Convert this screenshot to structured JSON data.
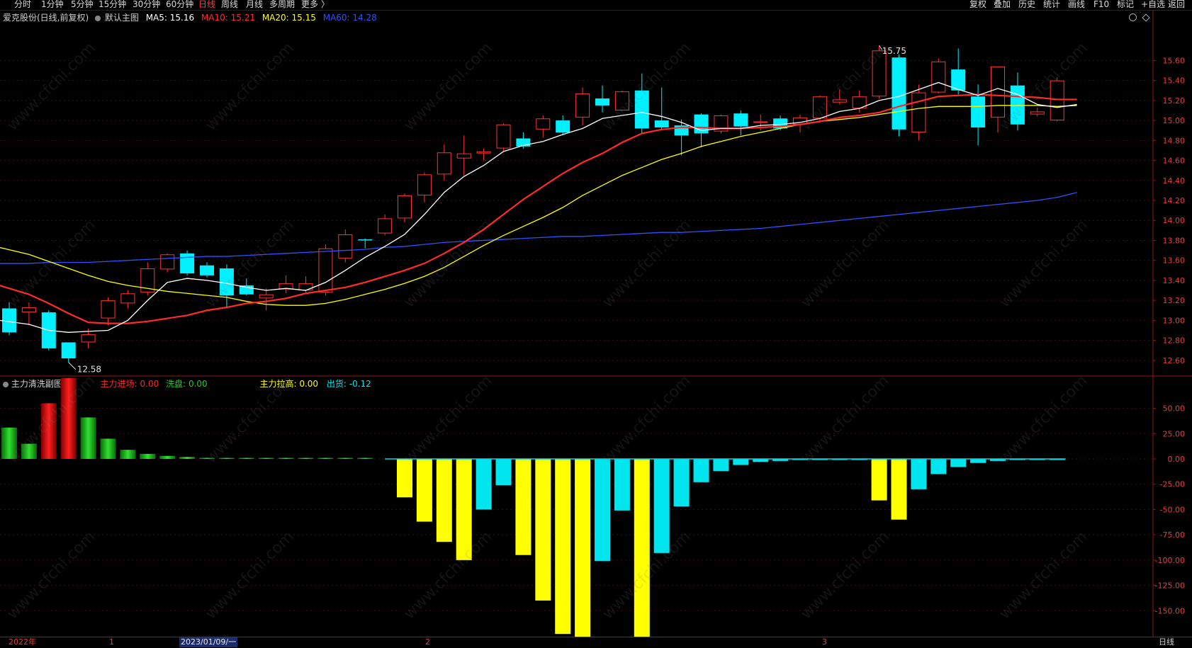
{
  "toolbar": {
    "tabs": [
      "分时",
      "1分钟",
      "5分钟",
      "15分钟",
      "30分钟",
      "60分钟",
      "日线",
      "周线",
      "月线",
      "多周期",
      "更多 〉"
    ],
    "active_tab": "日线",
    "right_buttons": [
      "复权",
      "叠加",
      "历史",
      "统计",
      "画线",
      "F10",
      "标记",
      "+自选",
      "返回"
    ]
  },
  "main_chart": {
    "title": "爱克股份(日线,前复权)",
    "template": "默认主图",
    "ma": [
      {
        "label": "MA5: ",
        "value": "15.16",
        "color": "#ffffff"
      },
      {
        "label": "MA10: ",
        "value": "15.21",
        "color": "#ff2a2a"
      },
      {
        "label": "MA20: ",
        "value": "15.15",
        "color": "#ffff00"
      },
      {
        "label": "MA60: ",
        "value": "14.28",
        "color": "#3050ff"
      }
    ],
    "high_label": "15.75",
    "low_label": "12.58",
    "y_ticks": [
      "15.60",
      "15.40",
      "15.20",
      "15.00",
      "14.80",
      "14.60",
      "14.40",
      "14.20",
      "14.00",
      "13.80",
      "13.60",
      "13.40",
      "13.20",
      "13.00",
      "12.80",
      "12.60"
    ]
  },
  "sub_chart": {
    "title": "主力清洗副图",
    "indicators": [
      {
        "label": "主力进场: ",
        "value": "0.00",
        "color": "#ff2a2a"
      },
      {
        "label": "洗盘: ",
        "value": "0.00",
        "color": "#20d020"
      },
      {
        "label": "主力拉高: ",
        "value": "0.00",
        "color": "#ffff00"
      },
      {
        "label": "出货: ",
        "value": "-0.12",
        "color": "#00e5ee"
      }
    ],
    "y_ticks": [
      "50.00",
      "25.00",
      "0.00",
      "-25.00",
      "-50.00",
      "-75.00",
      "-100.00",
      "-125.00",
      "-150.00"
    ]
  },
  "bottom_bar": {
    "labels": [
      "2022年",
      "1",
      "2023/01/09/一",
      "2",
      "3"
    ],
    "period": "日线"
  },
  "watermark": "www.cfchi.com",
  "chart_data": [
    {
      "type": "candlestick",
      "ylim": [
        12.45,
        15.95
      ],
      "candles": [
        [
          13.12,
          12.88,
          13.18,
          12.85
        ],
        [
          13.08,
          13.13,
          13.18,
          12.95
        ],
        [
          13.08,
          12.72,
          13.1,
          12.7
        ],
        [
          12.78,
          12.62,
          12.78,
          12.58
        ],
        [
          12.78,
          12.86,
          12.92,
          12.72
        ],
        [
          13.02,
          13.2,
          13.23,
          12.95
        ],
        [
          13.17,
          13.27,
          13.3,
          13.12
        ],
        [
          13.28,
          13.52,
          13.58,
          13.25
        ],
        [
          13.51,
          13.66,
          13.67,
          13.48
        ],
        [
          13.67,
          13.47,
          13.7,
          13.45
        ],
        [
          13.55,
          13.45,
          13.58,
          13.43
        ],
        [
          13.52,
          13.25,
          13.56,
          13.12
        ],
        [
          13.35,
          13.26,
          13.42,
          13.25
        ],
        [
          13.22,
          13.26,
          13.32,
          13.1
        ],
        [
          13.31,
          13.37,
          13.45,
          13.27
        ],
        [
          13.3,
          13.37,
          13.44,
          13.28
        ],
        [
          13.28,
          13.72,
          13.76,
          13.25
        ],
        [
          13.62,
          13.86,
          13.91,
          13.58
        ],
        [
          13.81,
          13.8,
          13.82,
          13.72
        ],
        [
          13.87,
          14.02,
          14.06,
          13.85
        ],
        [
          14.02,
          14.25,
          14.27,
          13.98
        ],
        [
          14.25,
          14.46,
          14.48,
          14.18
        ],
        [
          14.46,
          14.68,
          14.76,
          14.4
        ],
        [
          14.62,
          14.67,
          14.85,
          14.45
        ],
        [
          14.67,
          14.69,
          14.72,
          14.6
        ],
        [
          14.72,
          14.96,
          14.97,
          14.68
        ],
        [
          14.82,
          14.74,
          14.88,
          14.72
        ],
        [
          14.91,
          15.02,
          15.05,
          14.83
        ],
        [
          15.0,
          14.88,
          15.05,
          14.85
        ],
        [
          15.03,
          15.27,
          15.33,
          14.95
        ],
        [
          15.22,
          15.15,
          15.35,
          15.08
        ],
        [
          15.1,
          15.29,
          15.3,
          15.1
        ],
        [
          15.3,
          14.92,
          15.47,
          14.87
        ],
        [
          15.0,
          14.93,
          15.33,
          14.9
        ],
        [
          14.95,
          14.85,
          15.01,
          14.65
        ],
        [
          15.06,
          14.87,
          15.07,
          14.73
        ],
        [
          14.89,
          15.05,
          15.06,
          14.87
        ],
        [
          15.07,
          14.94,
          15.1,
          14.85
        ],
        [
          14.99,
          14.99,
          15.06,
          14.9
        ],
        [
          15.02,
          14.92,
          15.05,
          14.9
        ],
        [
          14.96,
          15.03,
          15.06,
          14.88
        ],
        [
          15.02,
          15.24,
          15.25,
          14.98
        ],
        [
          15.18,
          15.21,
          15.31,
          15.16
        ],
        [
          15.12,
          15.24,
          15.3,
          15.08
        ],
        [
          15.24,
          15.7,
          15.75,
          15.22
        ],
        [
          15.63,
          14.91,
          15.66,
          14.84
        ],
        [
          14.88,
          15.28,
          15.36,
          14.8
        ],
        [
          15.28,
          15.59,
          15.62,
          15.27
        ],
        [
          15.51,
          15.3,
          15.72,
          15.26
        ],
        [
          15.24,
          14.93,
          15.36,
          14.75
        ],
        [
          15.03,
          15.54,
          15.54,
          14.88
        ],
        [
          15.35,
          14.96,
          15.48,
          14.9
        ],
        [
          15.06,
          15.09,
          15.13,
          15.04
        ],
        [
          15.0,
          15.4,
          15.43,
          14.99
        ]
      ],
      "ma5": [
        13.0,
        12.96,
        12.9,
        12.88,
        12.89,
        12.9,
        13.0,
        13.2,
        13.38,
        13.42,
        13.4,
        13.37,
        13.33,
        13.3,
        13.32,
        13.3,
        13.38,
        13.5,
        13.63,
        13.74,
        13.86,
        14.06,
        14.28,
        14.44,
        14.55,
        14.69,
        14.75,
        14.79,
        14.86,
        14.92,
        15.02,
        15.05,
        15.08,
        15.04,
        14.98,
        14.9,
        14.92,
        14.92,
        14.95,
        14.96,
        14.98,
        15.02,
        15.09,
        15.12,
        15.2,
        15.24,
        15.31,
        15.38,
        15.31,
        15.25,
        15.32,
        15.26,
        15.16,
        15.13,
        15.16
      ],
      "ma10": [
        13.35,
        13.26,
        13.17,
        13.07,
        12.98,
        12.97,
        12.97,
        12.99,
        13.02,
        13.05,
        13.1,
        13.13,
        13.17,
        13.19,
        13.22,
        13.27,
        13.3,
        13.33,
        13.38,
        13.44,
        13.5,
        13.57,
        13.67,
        13.78,
        13.91,
        14.06,
        14.21,
        14.34,
        14.47,
        14.58,
        14.67,
        14.78,
        14.87,
        14.91,
        14.93,
        14.93,
        14.92,
        14.92,
        14.93,
        14.94,
        14.96,
        14.99,
        15.03,
        15.05,
        15.08,
        15.14,
        15.19,
        15.24,
        15.25,
        15.26,
        15.25,
        15.24,
        15.23,
        15.21,
        15.21
      ],
      "ma20": [
        13.73,
        13.66,
        13.59,
        13.52,
        13.45,
        13.39,
        13.35,
        13.32,
        13.29,
        13.27,
        13.25,
        13.23,
        13.19,
        13.16,
        13.15,
        13.15,
        13.17,
        13.21,
        13.26,
        13.31,
        13.37,
        13.44,
        13.53,
        13.64,
        13.75,
        13.85,
        13.94,
        14.03,
        14.13,
        14.25,
        14.35,
        14.45,
        14.53,
        14.61,
        14.67,
        14.74,
        14.79,
        14.84,
        14.88,
        14.92,
        14.96,
        14.99,
        15.01,
        15.03,
        15.06,
        15.09,
        15.12,
        15.14,
        15.14,
        15.14,
        15.15,
        15.15,
        15.15,
        15.14,
        15.15
      ],
      "ma60": [
        13.57,
        13.57,
        13.58,
        13.58,
        13.58,
        13.59,
        13.6,
        13.61,
        13.62,
        13.63,
        13.64,
        13.64,
        13.65,
        13.66,
        13.67,
        13.68,
        13.69,
        13.7,
        13.71,
        13.73,
        13.74,
        13.76,
        13.78,
        13.79,
        13.8,
        13.81,
        13.82,
        13.83,
        13.84,
        13.84,
        13.85,
        13.86,
        13.87,
        13.88,
        13.88,
        13.89,
        13.9,
        13.91,
        13.92,
        13.94,
        13.96,
        13.98,
        14.0,
        14.02,
        14.04,
        14.06,
        14.08,
        14.1,
        14.12,
        14.14,
        14.16,
        14.18,
        14.2,
        14.23,
        14.28
      ]
    },
    {
      "type": "bar",
      "ylim": [
        -175,
        70
      ],
      "series": [
        {
          "name": "主力进场",
          "values": [
            0,
            0,
            55,
            80,
            0,
            0,
            0,
            0,
            0,
            0,
            0,
            0,
            0,
            0,
            0,
            0,
            0,
            0,
            0,
            0,
            0,
            0,
            0,
            0,
            0,
            0,
            0,
            0,
            0,
            0,
            0,
            0,
            0,
            0,
            0,
            0,
            0,
            0,
            0,
            0,
            0,
            0,
            0,
            0,
            0,
            0,
            0,
            0,
            0,
            0,
            0,
            0,
            0,
            0
          ]
        },
        {
          "name": "洗盘",
          "values": [
            31,
            15,
            0,
            0,
            41,
            20,
            9,
            5,
            3,
            2,
            1,
            1,
            1,
            1,
            1,
            1,
            1,
            1,
            1,
            0,
            0,
            0,
            0,
            0,
            0,
            0,
            0,
            0,
            0,
            0,
            0,
            0,
            0,
            0,
            0,
            0,
            0,
            0,
            0,
            0,
            0,
            0,
            0,
            0,
            0,
            0,
            0,
            0,
            0,
            0,
            0,
            0,
            0,
            0
          ]
        },
        {
          "name": "主力拉高",
          "values": [
            0,
            0,
            0,
            0,
            0,
            0,
            0,
            0,
            0,
            0,
            0,
            0,
            0,
            0,
            0,
            0,
            0,
            0,
            0,
            0,
            -38,
            -62,
            -82,
            -100,
            0,
            0,
            -95,
            -140,
            -173,
            -200,
            0,
            0,
            -185,
            0,
            0,
            0,
            0,
            0,
            0,
            0,
            0,
            0,
            0,
            0,
            -41,
            -60,
            0,
            0,
            0,
            0,
            0,
            0,
            0,
            0
          ]
        },
        {
          "name": "出货",
          "values": [
            0,
            0,
            0,
            0,
            0,
            0,
            0,
            0,
            0,
            0,
            0,
            0,
            0,
            0,
            0,
            0,
            0,
            0,
            0,
            0,
            0,
            0,
            0,
            0,
            -50,
            -26,
            0,
            0,
            0,
            0,
            -101,
            -51,
            0,
            -93,
            -47,
            -23,
            -12,
            -6,
            -3,
            -2,
            -1,
            -1,
            -1,
            -1,
            0,
            0,
            -30,
            -15,
            -8,
            -4,
            -2,
            -1,
            -1,
            -0.12
          ]
        }
      ]
    }
  ]
}
